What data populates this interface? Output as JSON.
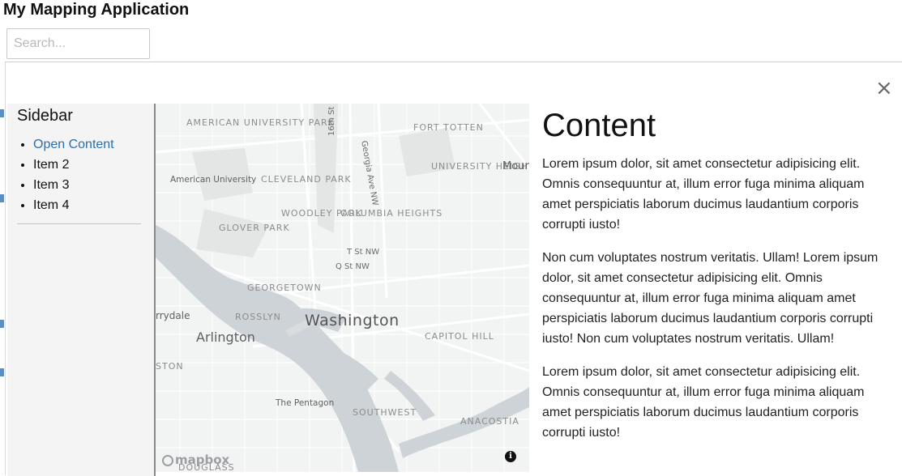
{
  "app": {
    "title": "My Mapping Application"
  },
  "search": {
    "placeholder": "Search..."
  },
  "panel": {
    "close_label": "×"
  },
  "sidebar": {
    "title": "Sidebar",
    "items": [
      {
        "label": "Open Content"
      },
      {
        "label": "Item 2"
      },
      {
        "label": "Item 3"
      },
      {
        "label": "Item 4"
      }
    ]
  },
  "map": {
    "labels": {
      "american_university_park": "AMERICAN UNIVERSITY PARK",
      "fort_totten": "FORT TOTTEN",
      "university_heights": "UNIVERSITY HEIGHTS",
      "mount": "Mour",
      "american_university": "American University",
      "cleveland_park": "CLEVELAND PARK",
      "woodley_park": "WOODLEY PARK",
      "columbia_heights": "COLUMBIA HEIGHTS",
      "glover_park": "GLOVER PARK",
      "georgetown": "GEORGETOWN",
      "rosslyn": "ROSSLYN",
      "washington": "Washington",
      "arlington": "Arlington",
      "capitol_hill": "CAPITOL HILL",
      "pentagon": "The Pentagon",
      "southwest": "SOUTHWEST",
      "anacostia": "ANACOSTIA",
      "douglass": "DOUGLASS",
      "ston": "STON",
      "rrydale": "rrydale",
      "t_st": "T St NW",
      "q_st": "Q St NW",
      "sixteenth": "16th St NW",
      "georgia": "Georgia Ave NW"
    },
    "logo": "mapbox",
    "info": "i"
  },
  "content": {
    "title": "Content",
    "paragraphs": [
      "Lorem ipsum dolor, sit amet consectetur adipisicing elit. Omnis consequuntur at, illum error fuga minima aliquam amet perspiciatis laborum ducimus laudantium corporis corrupti iusto!",
      "Non cum voluptates nostrum veritatis. Ullam! Lorem ipsum dolor, sit amet consectetur adipisicing elit. Omnis consequuntur at, illum error fuga minima aliquam amet perspiciatis laborum ducimus laudantium corporis corrupti iusto! Non cum voluptates nostrum veritatis. Ullam!",
      "Lorem ipsum dolor, sit amet consectetur adipisicing elit. Omnis consequuntur at, illum error fuga minima aliquam amet perspiciatis laborum ducimus laudantium corporis corrupti iusto!"
    ]
  },
  "colors": {
    "link": "#2a6fab",
    "water": "#cdd3d6",
    "sidebar_bg": "#f4f4f4"
  }
}
